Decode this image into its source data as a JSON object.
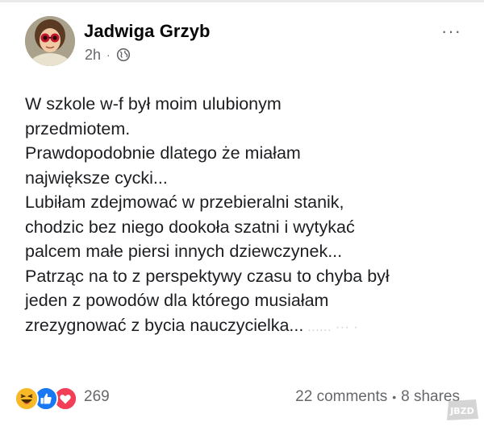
{
  "post": {
    "author": "Jadwiga Grzyb",
    "time": "2h",
    "separator": "·",
    "privacy_icon": "globe-icon",
    "more_icon": "more-options-icon",
    "more_glyph": "···",
    "lines": [
      "W szkole w-f był moim ulubionym",
      "przedmiotem.",
      "Prawdopodobnie dlatego że miałam",
      "największe cycki...",
      "Lubiłam zdejmować w przebieralni stanik,",
      "chodzic bez niego dookoła szatni i wytykać",
      "palcem małe piersi innych dziewczynek...",
      "Patrząc na to z perspektywy czasu to chyba był",
      "jeden z powodów dla którego musiałam",
      "zrezygnować z bycia nauczycielka..."
    ]
  },
  "reactions": {
    "icons": [
      "haha-reaction-icon",
      "like-reaction-icon",
      "love-reaction-icon"
    ],
    "count": "269",
    "comments": "22 comments",
    "dot": "•",
    "shares": "8 shares"
  },
  "colors": {
    "text": "#1c1e21",
    "meta": "#65676b",
    "like": "#1877f2",
    "love": "#f33e58",
    "haha": "#f7b928"
  },
  "watermark": "JBZD"
}
